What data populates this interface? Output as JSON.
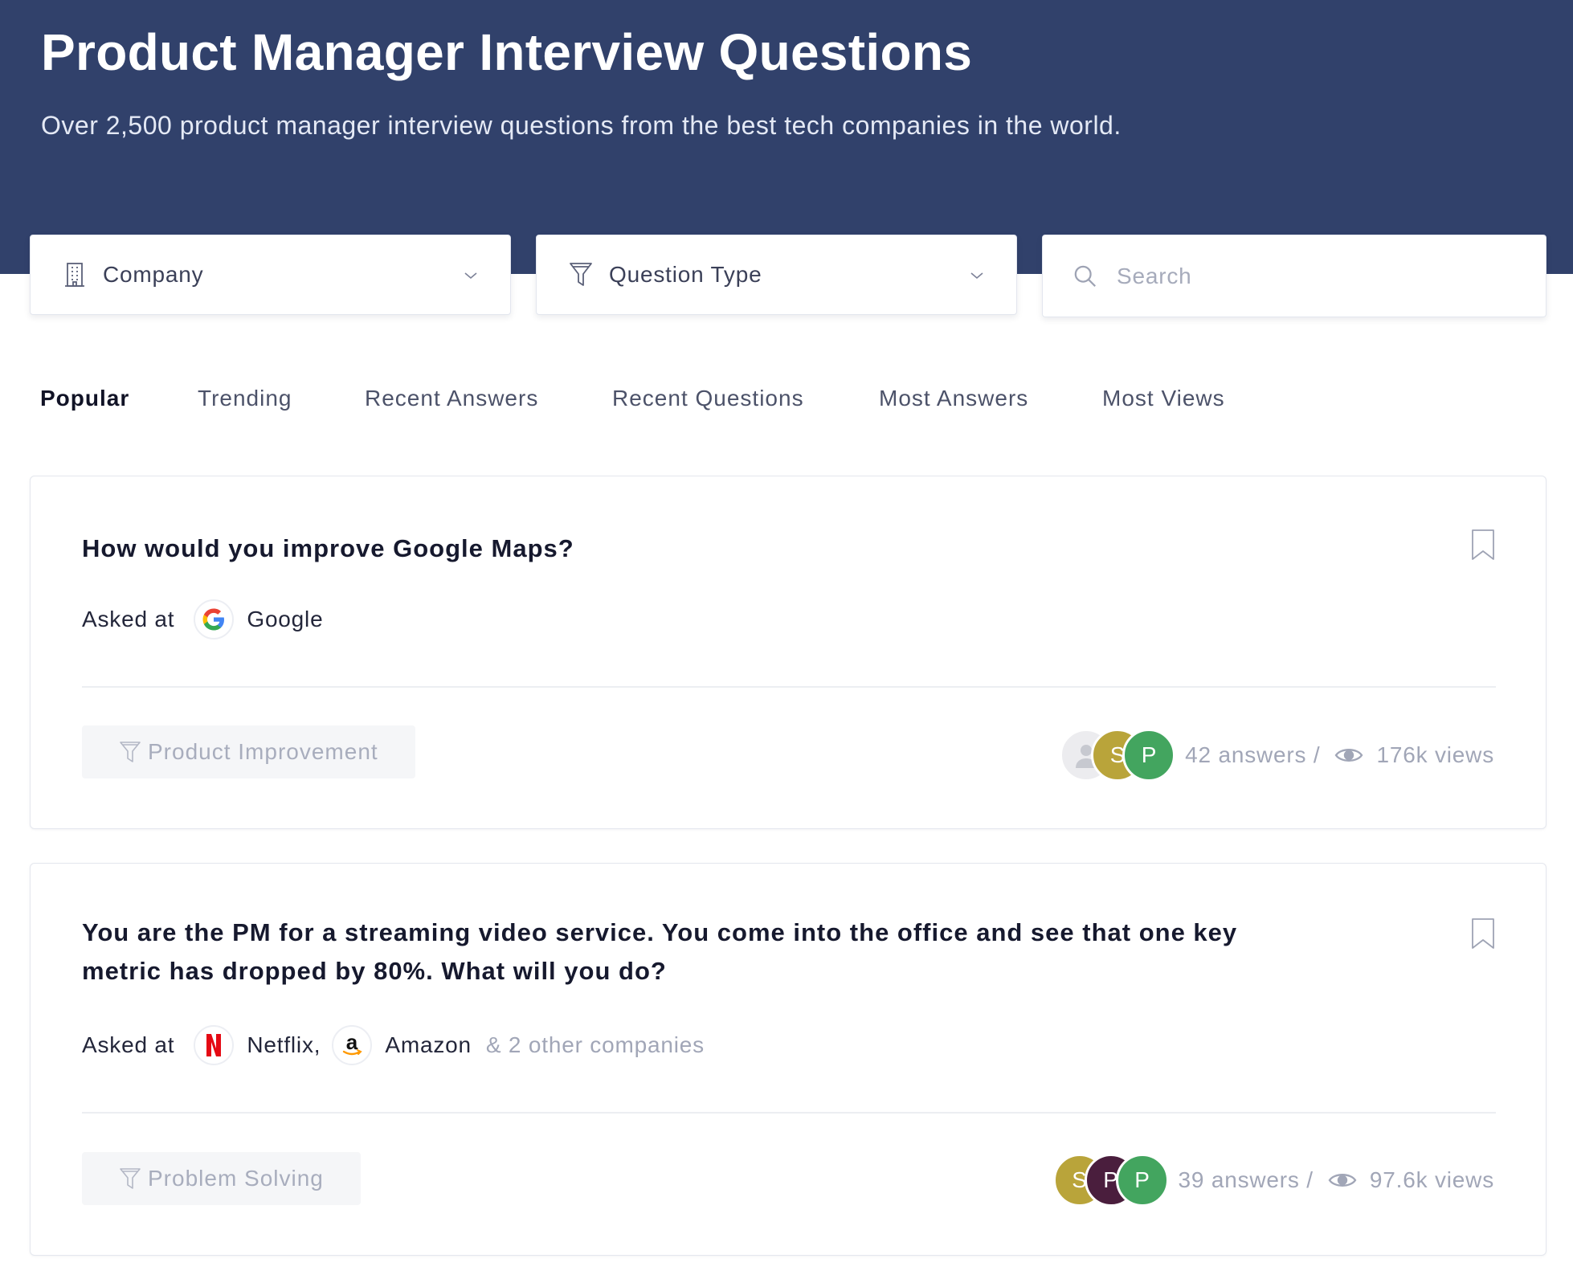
{
  "hero": {
    "title": "Product Manager Interview Questions",
    "subtitle": "Over 2,500 product manager interview questions from the best tech companies in the world."
  },
  "filters": {
    "company": {
      "label": "Company",
      "icon": "building-icon"
    },
    "question_type": {
      "label": "Question Type",
      "icon": "filter-icon"
    },
    "search": {
      "placeholder": "Search",
      "value": "",
      "icon": "search-icon"
    }
  },
  "tabs": [
    {
      "label": "Popular",
      "active": true
    },
    {
      "label": "Trending",
      "active": false
    },
    {
      "label": "Recent Answers",
      "active": false
    },
    {
      "label": "Recent Questions",
      "active": false
    },
    {
      "label": "Most Answers",
      "active": false
    },
    {
      "label": "Most Views",
      "active": false
    }
  ],
  "questions": [
    {
      "title": "How would you improve Google Maps?",
      "asked_label": "Asked at",
      "companies": [
        {
          "name": "Google",
          "logo": "google-logo"
        }
      ],
      "others": "",
      "tag": "Product Improvement",
      "avatars": [
        {
          "initial": "",
          "color": "#ececef",
          "placeholder": true
        },
        {
          "initial": "S",
          "color": "#b9a43a"
        },
        {
          "initial": "P",
          "color": "#43a55f"
        }
      ],
      "answers": "42 answers /",
      "views": "176k views"
    },
    {
      "title": "You are the PM for a streaming video service. You come into the office and see that one key metric has dropped by 80%. What will you do?",
      "asked_label": "Asked at",
      "companies": [
        {
          "name": "Netflix,",
          "logo": "netflix-logo"
        },
        {
          "name": "Amazon",
          "logo": "amazon-logo"
        }
      ],
      "others": "& 2 other companies",
      "tag": "Problem Solving",
      "avatars": [
        {
          "initial": "S",
          "color": "#b9a43a"
        },
        {
          "initial": "P",
          "color": "#4a1e3d"
        },
        {
          "initial": "P",
          "color": "#43a55f"
        }
      ],
      "answers": "39 answers /",
      "views": "97.6k views"
    }
  ],
  "colors": {
    "hero_bg": "#31416b",
    "text_dark": "#16192e",
    "muted": "#a1a6b7"
  }
}
